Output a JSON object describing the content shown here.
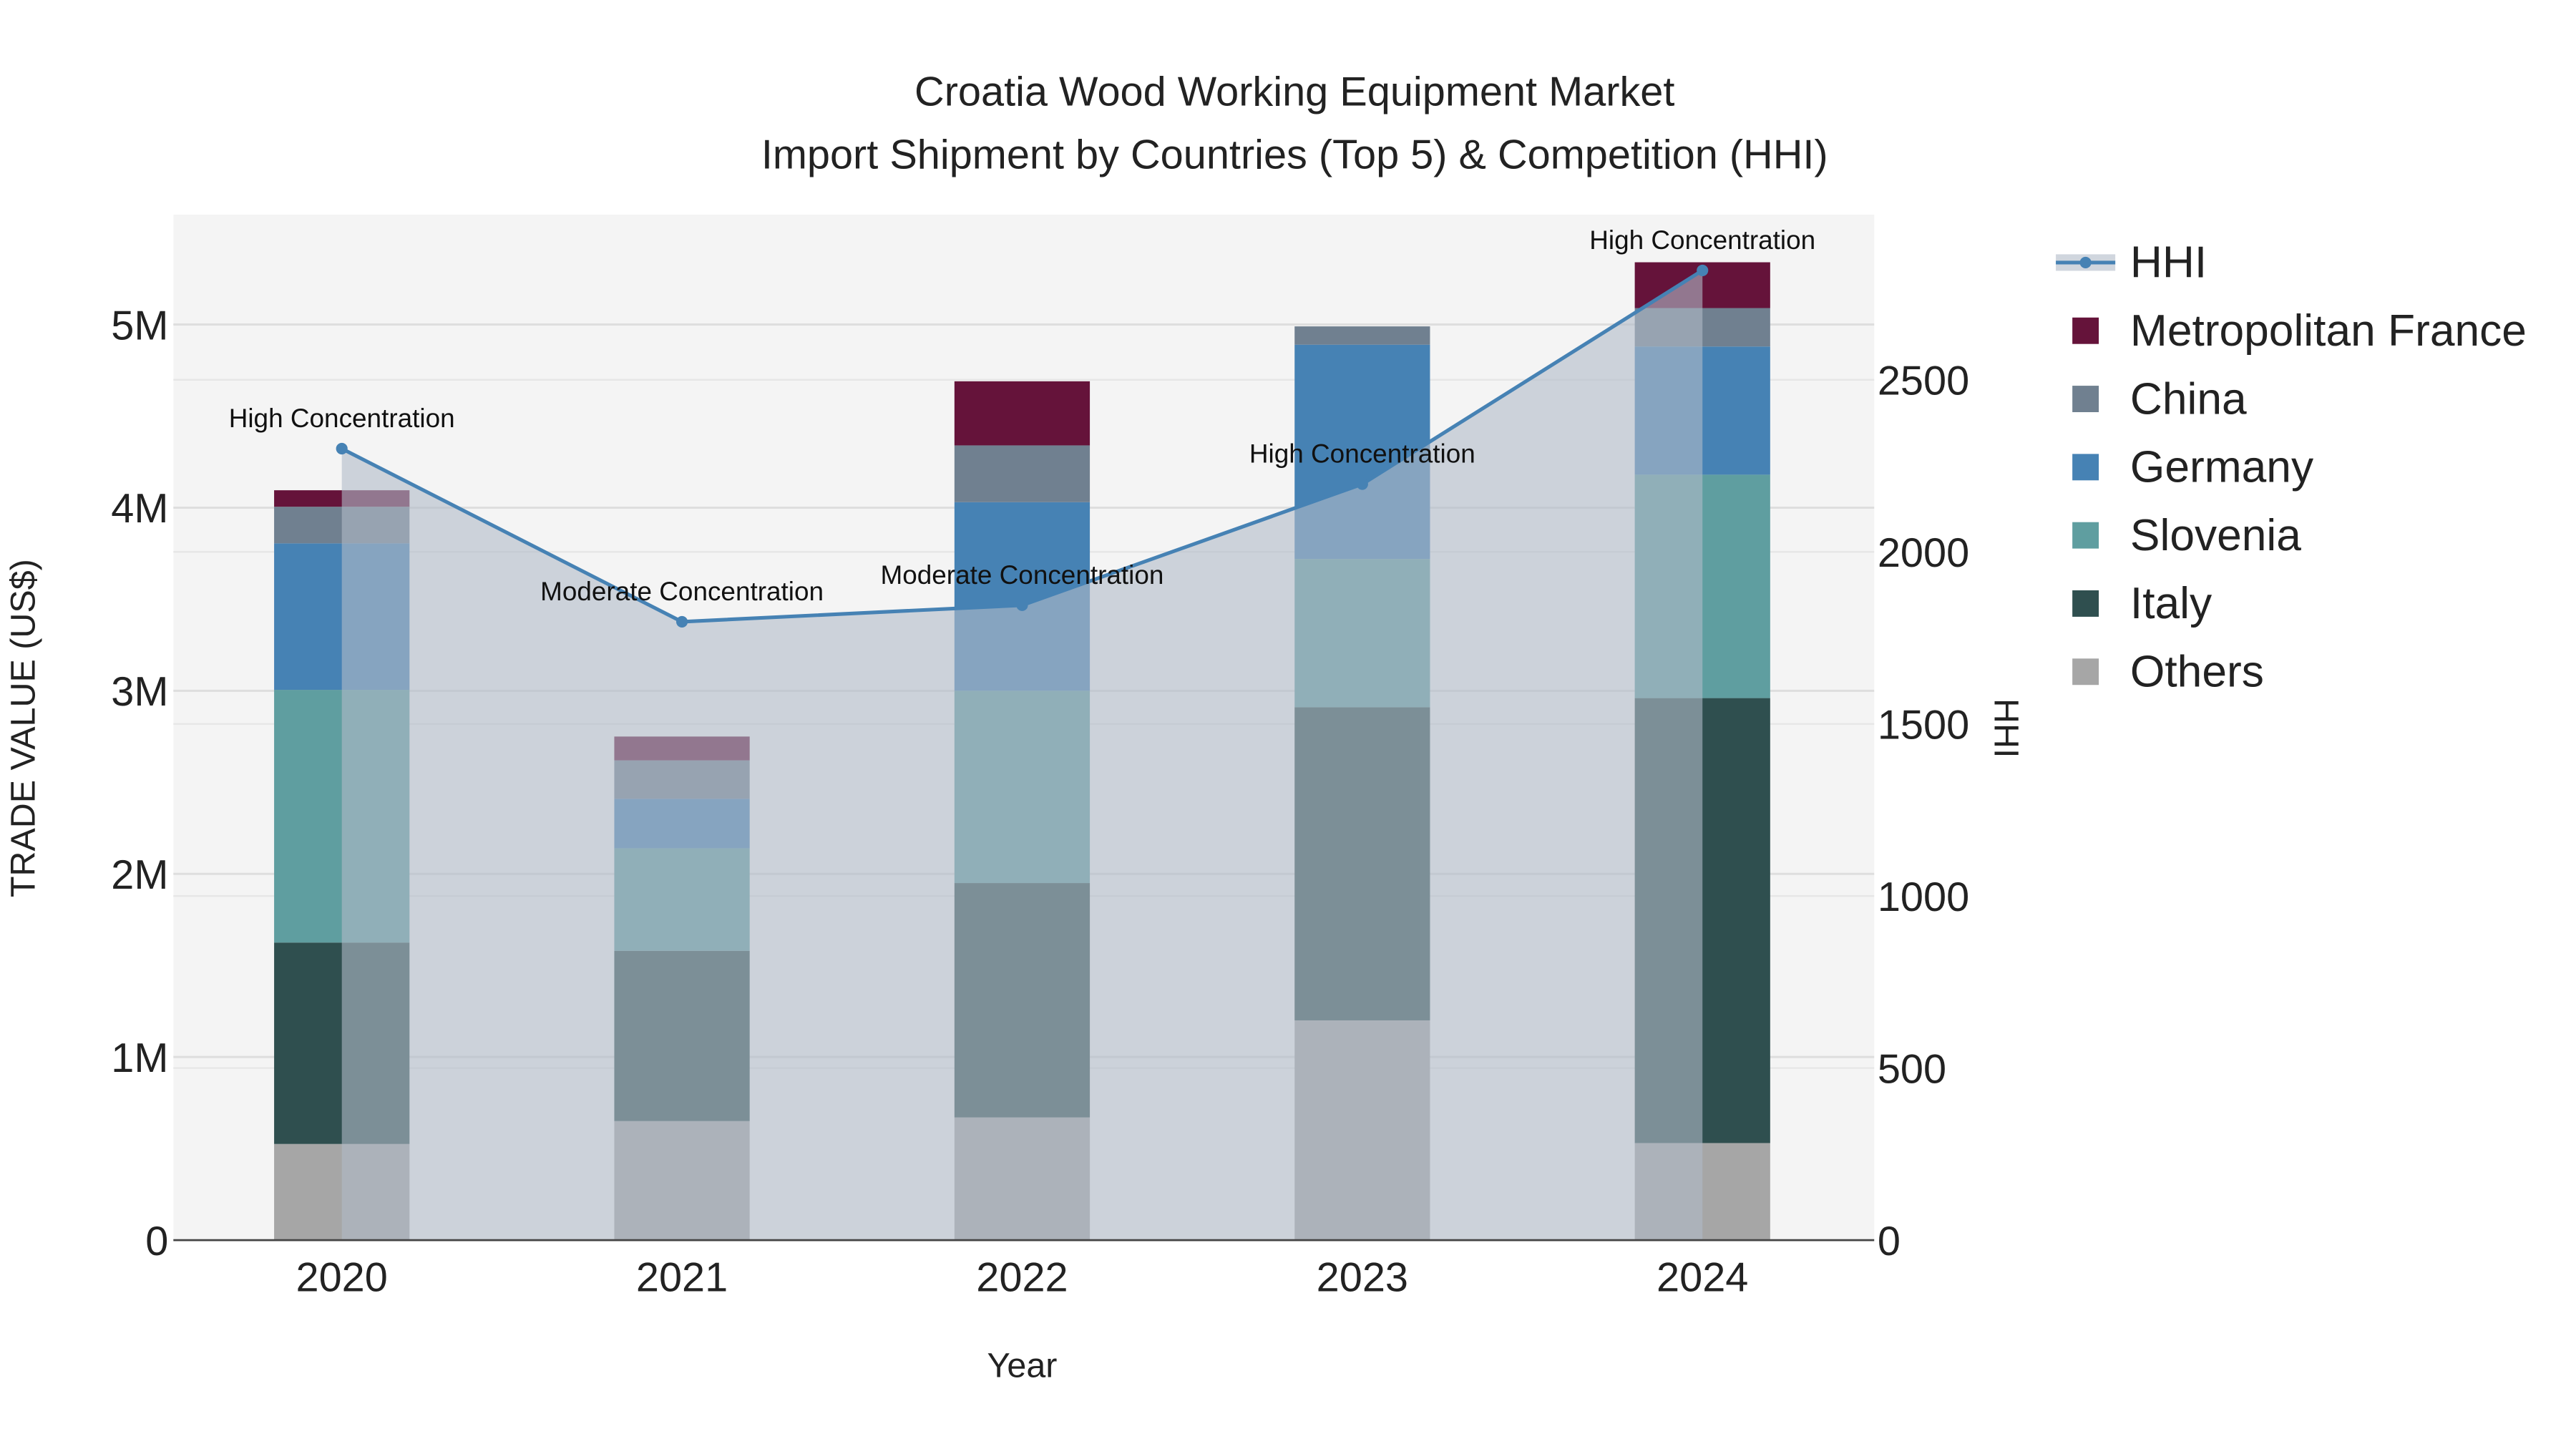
{
  "chart_data": {
    "type": "bar",
    "stacked": true,
    "title": "Croatia Wood Working Equipment Market",
    "subtitle": "Import Shipment by Countries (Top 5) & Competition (HHI)",
    "xlabel": "Year",
    "ylabel": "TRADE VALUE (US$)",
    "y2label": "HHI",
    "categories": [
      "2020",
      "2021",
      "2022",
      "2023",
      "2024"
    ],
    "ylim": [
      0,
      5600000
    ],
    "y2lim": [
      0,
      2980
    ],
    "yticks": [
      {
        "v": 0,
        "t": "0"
      },
      {
        "v": 1000000,
        "t": "1M"
      },
      {
        "v": 2000000,
        "t": "2M"
      },
      {
        "v": 3000000,
        "t": "3M"
      },
      {
        "v": 4000000,
        "t": "4M"
      },
      {
        "v": 5000000,
        "t": "5M"
      }
    ],
    "y2ticks": [
      {
        "v": 0,
        "t": "0"
      },
      {
        "v": 500,
        "t": "500"
      },
      {
        "v": 1000,
        "t": "1000"
      },
      {
        "v": 1500,
        "t": "1500"
      },
      {
        "v": 2000,
        "t": "2000"
      },
      {
        "v": 2500,
        "t": "2500"
      }
    ],
    "series": [
      {
        "name": "Others",
        "color": "#a6a6a6",
        "values": [
          525000,
          650000,
          670000,
          1200000,
          530000
        ]
      },
      {
        "name": "Italy",
        "color": "#2f4f4f",
        "values": [
          1100000,
          930000,
          1280000,
          1710000,
          2430000
        ]
      },
      {
        "name": "Slovenia",
        "color": "#5f9ea0",
        "values": [
          1380000,
          560000,
          1050000,
          810000,
          1220000
        ]
      },
      {
        "name": "Germany",
        "color": "#4682b4",
        "values": [
          800000,
          270000,
          1030000,
          1170000,
          700000
        ]
      },
      {
        "name": "China",
        "color": "#708090",
        "values": [
          200000,
          210000,
          310000,
          100000,
          210000
        ]
      },
      {
        "name": "Metropolitan France",
        "color": "#65133a",
        "values": [
          90000,
          130000,
          350000,
          0,
          250000
        ]
      }
    ],
    "line": {
      "name": "HHI",
      "color": "#4682b4",
      "values": [
        2300,
        1797,
        1845,
        2197,
        2818
      ],
      "annotations": [
        "High Concentration",
        "Moderate Concentration",
        "Moderate Concentration",
        "High Concentration",
        "High Concentration"
      ]
    },
    "legend_position": "right",
    "legend_order": [
      "HHI",
      "Metropolitan France",
      "China",
      "Germany",
      "Slovenia",
      "Italy",
      "Others"
    ]
  }
}
